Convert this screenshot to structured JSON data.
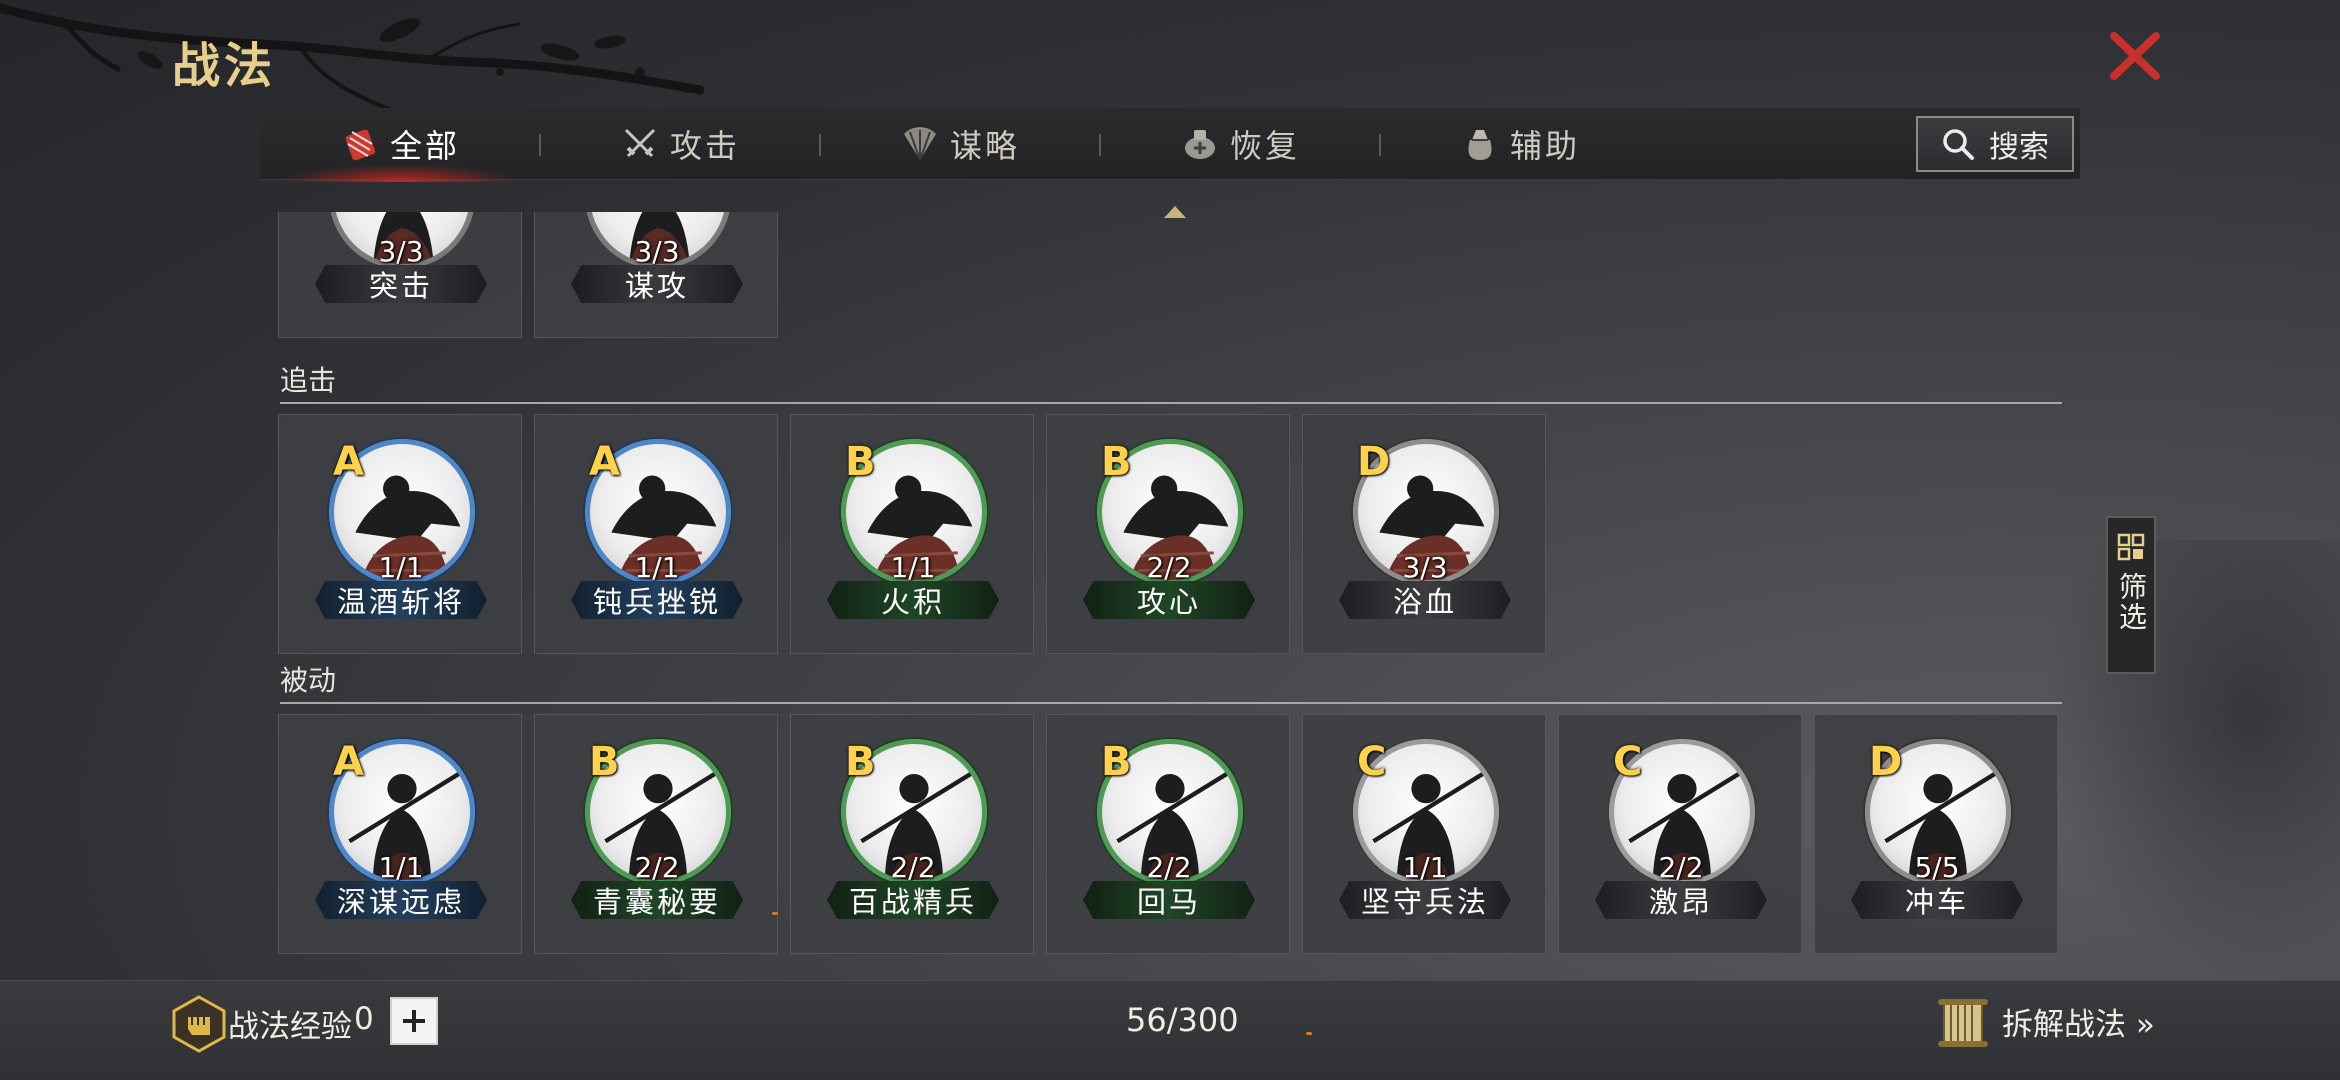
{
  "title": "战法",
  "tabs": [
    {
      "label": "全部",
      "icon": "bundle-icon",
      "active": true
    },
    {
      "label": "攻击",
      "icon": "crossed-swords-icon",
      "active": false
    },
    {
      "label": "谋略",
      "icon": "hand-fan-icon",
      "active": false
    },
    {
      "label": "恢复",
      "icon": "medicine-icon",
      "active": false
    },
    {
      "label": "辅助",
      "icon": "supply-bag-icon",
      "active": false
    }
  ],
  "search": {
    "label": "搜索"
  },
  "sections": {
    "top": {
      "cards": [
        {
          "count": "3/3",
          "name": "突击"
        },
        {
          "count": "3/3",
          "name": "谋攻"
        }
      ]
    },
    "pursuit": {
      "title": "追击",
      "cards": [
        {
          "grade": "A",
          "count": "1/1",
          "name": "温酒斩将"
        },
        {
          "grade": "A",
          "count": "1/1",
          "name": "钝兵挫锐"
        },
        {
          "grade": "B",
          "count": "1/1",
          "name": "火积"
        },
        {
          "grade": "B",
          "count": "2/2",
          "name": "攻心"
        },
        {
          "grade": "D",
          "count": "3/3",
          "name": "浴血"
        }
      ]
    },
    "passive": {
      "title": "被动",
      "cards": [
        {
          "grade": "A",
          "count": "1/1",
          "name": "深谋远虑"
        },
        {
          "grade": "B",
          "count": "2/2",
          "name": "青囊秘要"
        },
        {
          "grade": "B",
          "count": "2/2",
          "name": "百战精兵"
        },
        {
          "grade": "B",
          "count": "2/2",
          "name": "回马"
        },
        {
          "grade": "C",
          "count": "1/1",
          "name": "坚守兵法"
        },
        {
          "grade": "C",
          "count": "2/2",
          "name": "激昂"
        },
        {
          "grade": "D",
          "count": "5/5",
          "name": "冲车"
        }
      ]
    }
  },
  "filter": {
    "label": "筛选"
  },
  "bottom": {
    "exp_label": "战法经验",
    "exp_value": "0",
    "capacity": "56/300",
    "dismantle_label": "拆解战法 »"
  },
  "colors": {
    "title_gold": "#e6cf8a",
    "grade_gold": "#ffd24a",
    "close_red": "#c9302c",
    "grade_A": "#4f86c8",
    "grade_B": "#4f9a56",
    "grade_C": "#9b9b9b",
    "grade_D": "#8c8c8c"
  }
}
